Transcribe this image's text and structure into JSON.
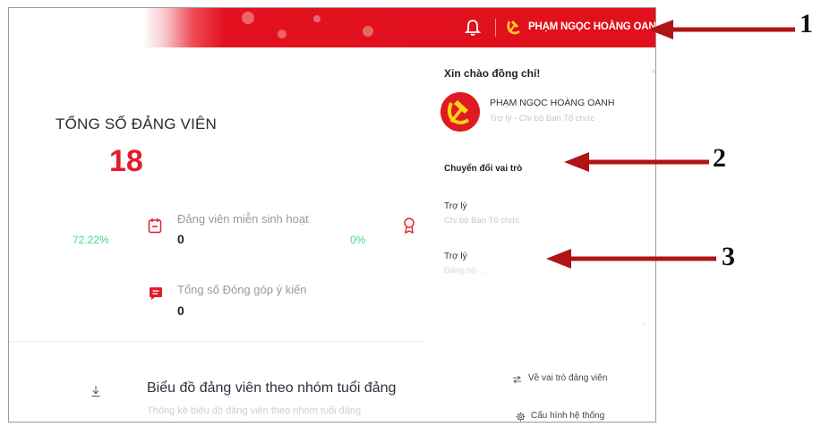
{
  "header": {
    "user_name": "PHẠM NGỌC HOÀNG OANH"
  },
  "stats": {
    "total_title": "TỔNG SỐ ĐẢNG VIÊN",
    "total_value": "18",
    "exempt_pct": "72.22%",
    "exempt_label": "Đảng viên miễn sinh hoạt",
    "exempt_value": "0",
    "mid_pct": "0%",
    "feedback_label": "Tổng số Đóng góp ý kiến",
    "feedback_value": "0"
  },
  "chart_section": {
    "title": "Biểu đồ đảng viên theo nhóm tuổi đảng",
    "subtitle": "Thống kê biểu đồ đảng viên theo nhóm tuổi đảng"
  },
  "panel": {
    "greeting": "Xin chào đồng chí!",
    "close": "×",
    "name": "PHẠM NGỌC HOÀNG OANH",
    "role": "Trợ lý - Chi bộ Ban Tổ chức",
    "switch_role_label": "Chuyển đổi vai trò",
    "roles": [
      {
        "title": "Trợ lý",
        "org": "Chi bộ Ban Tổ chức"
      },
      {
        "title": "Trợ lý",
        "org": "Đảng bộ ..."
      }
    ],
    "back_label": "Về vai trò đảng viên",
    "config_label": "Cấu hình hệ thống"
  },
  "annotations": {
    "label_1": "1",
    "label_2": "2",
    "label_3": "3"
  },
  "colors": {
    "brand_red": "#e0101c",
    "value_red": "#e11d2a",
    "pct_green": "#3ddc84"
  }
}
